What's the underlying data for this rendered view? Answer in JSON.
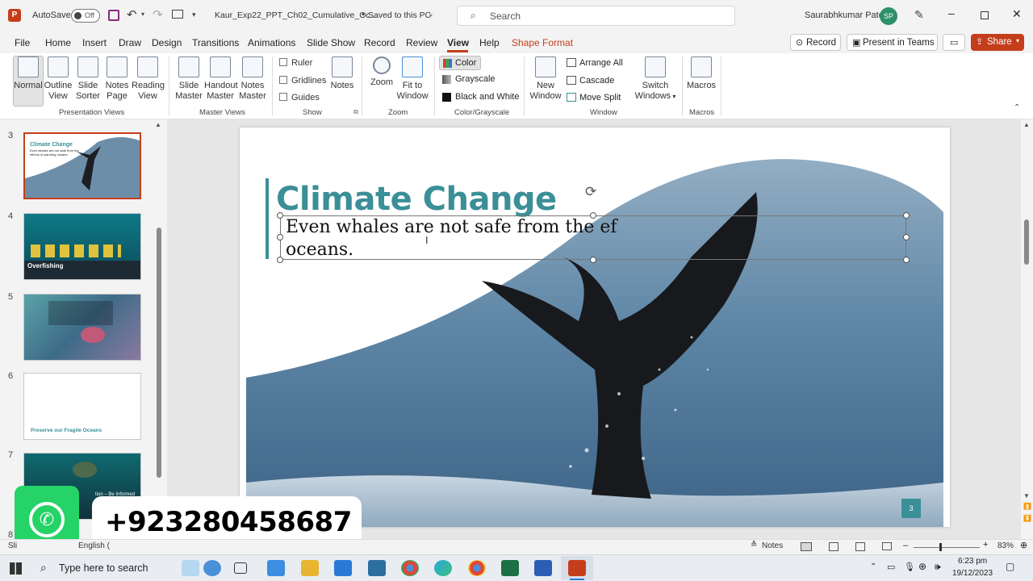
{
  "titlebar": {
    "autosave_label": "AutoSave",
    "autosave_state": "Off",
    "filename": "Kaur_Exp22_PPT_Ch02_Cumulative_Oc...",
    "save_status": "Saved to this PC",
    "search_placeholder": "Search",
    "user_name": "Saurabhkumar Patel",
    "user_initials": "SP"
  },
  "menu": {
    "items": [
      "File",
      "Home",
      "Insert",
      "Draw",
      "Design",
      "Transitions",
      "Animations",
      "Slide Show",
      "Record",
      "Review",
      "View",
      "Help",
      "Shape Format"
    ],
    "active": "View",
    "record_btn": "Record",
    "present_btn": "Present in Teams",
    "share_btn": "Share"
  },
  "ribbon": {
    "presentation_views": {
      "label": "Presentation Views",
      "buttons": [
        [
          "Normal",
          ""
        ],
        [
          "Outline",
          "View"
        ],
        [
          "Slide",
          "Sorter"
        ],
        [
          "Notes",
          "Page"
        ],
        [
          "Reading",
          "View"
        ]
      ]
    },
    "master_views": {
      "label": "Master Views",
      "buttons": [
        [
          "Slide",
          "Master"
        ],
        [
          "Handout",
          "Master"
        ],
        [
          "Notes",
          "Master"
        ]
      ]
    },
    "show": {
      "label": "Show",
      "ruler": "Ruler",
      "gridlines": "Gridlines",
      "guides": "Guides",
      "notes": "Notes"
    },
    "zoom": {
      "label": "Zoom",
      "zoom": "Zoom",
      "fit1": "Fit to",
      "fit2": "Window"
    },
    "color": {
      "label": "Color/Grayscale",
      "color": "Color",
      "grayscale": "Grayscale",
      "bw": "Black and White"
    },
    "window": {
      "label": "Window",
      "new1": "New",
      "new2": "Window",
      "arrange": "Arrange All",
      "cascade": "Cascade",
      "move_split": "Move Split",
      "switch1": "Switch",
      "switch2": "Windows"
    },
    "macros": {
      "label": "Macros",
      "macros": "Macros"
    }
  },
  "thumbnails": {
    "nums": [
      "3",
      "4",
      "5",
      "6",
      "7",
      "8"
    ],
    "t3_title": "Climate Change",
    "t3_sub": "Even whales are not safe from the effects of warming oceans.",
    "t4_label": "Overfishing",
    "t6_label": "Preserve our Fragile Oceans",
    "t7_label": "tion – Be Informed"
  },
  "slide": {
    "title": "Climate Change",
    "line1": "Even whales are not safe from the ef",
    "line2": "oceans.",
    "number": "3"
  },
  "overlay": {
    "phone": "+923280458687"
  },
  "statusbar": {
    "left": "Sli",
    "language": "English (",
    "notes": "Notes",
    "zoom": "83%"
  },
  "taskbar": {
    "search_placeholder": "Type here to search",
    "time": "6:23 pm",
    "date": "19/12/2023"
  },
  "colors": {
    "accent": "#c43e1c",
    "teal": "#3b8f97",
    "whatsapp": "#25d366"
  }
}
